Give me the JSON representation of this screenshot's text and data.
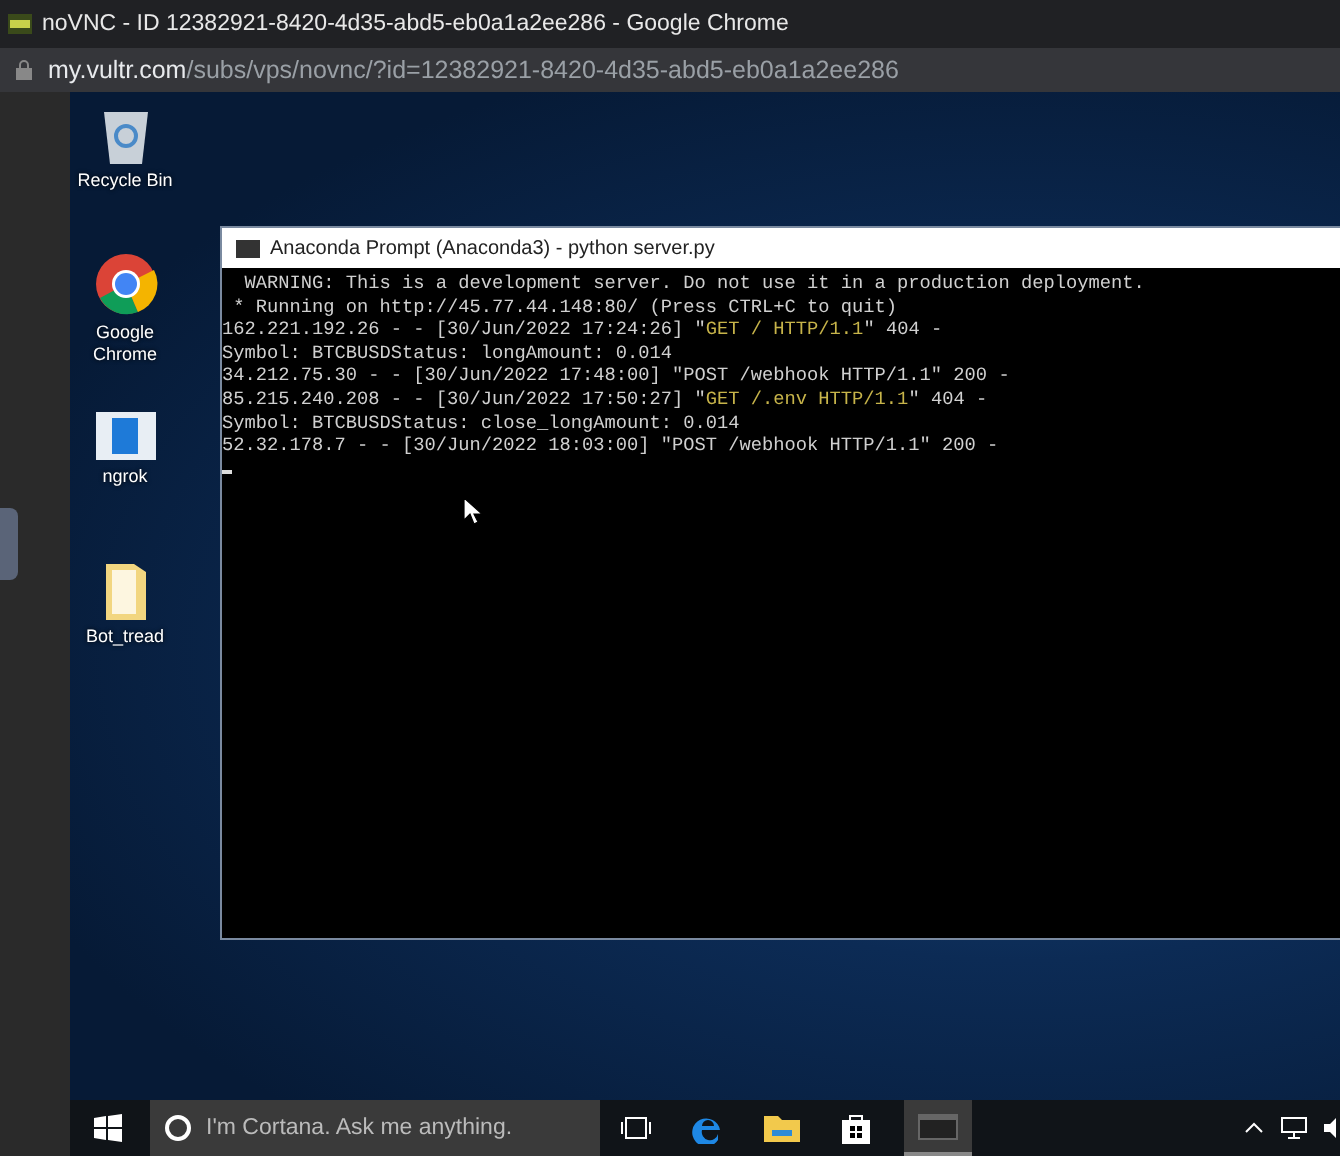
{
  "browser": {
    "title": "noVNC - ID 12382921-8420-4d35-abd5-eb0a1a2ee286 - Google Chrome",
    "url_host": "my.vultr.com",
    "url_path": "/subs/vps/novnc/?id=12382921-8420-4d35-abd5-eb0a1a2ee286"
  },
  "desktop_icons": [
    {
      "kind": "recycle",
      "label": "Recycle Bin"
    },
    {
      "kind": "chrome",
      "label": "Google Chrome"
    },
    {
      "kind": "app",
      "label": "ngrok"
    },
    {
      "kind": "folder",
      "label": "Bot_tread"
    }
  ],
  "terminal": {
    "title": "Anaconda Prompt (Anaconda3) - python  server.py",
    "lines": [
      [
        {
          "kind": "plain",
          "text": "  WARNING: This is a development server. Do not use it in a production deployment."
        }
      ],
      [
        {
          "kind": "plain",
          "text": " * Running on http://45.77.44.148:80/ (Press CTRL+C to quit)"
        }
      ],
      [
        {
          "kind": "plain",
          "text": "162.221.192.26 - - [30/Jun/2022 17:24:26] \""
        },
        {
          "kind": "request",
          "text": "GET / HTTP/1.1"
        },
        {
          "kind": "plain",
          "text": "\" 404 -"
        }
      ],
      [
        {
          "kind": "plain",
          "text": "Symbol: BTCBUSDStatus: longAmount: 0.014"
        }
      ],
      [
        {
          "kind": "plain",
          "text": "34.212.75.30 - - [30/Jun/2022 17:48:00] \"POST /webhook HTTP/1.1\" 200 -"
        }
      ],
      [
        {
          "kind": "plain",
          "text": "85.215.240.208 - - [30/Jun/2022 17:50:27] \""
        },
        {
          "kind": "request",
          "text": "GET /.env HTTP/1.1"
        },
        {
          "kind": "plain",
          "text": "\" 404 -"
        }
      ],
      [
        {
          "kind": "plain",
          "text": "Symbol: BTCBUSDStatus: close_longAmount: 0.014"
        }
      ],
      [
        {
          "kind": "plain",
          "text": "52.32.178.7 - - [30/Jun/2022 18:03:00] \"POST /webhook HTTP/1.1\" 200 -"
        }
      ]
    ]
  },
  "taskbar": {
    "search_placeholder": "I'm Cortana. Ask me anything."
  }
}
